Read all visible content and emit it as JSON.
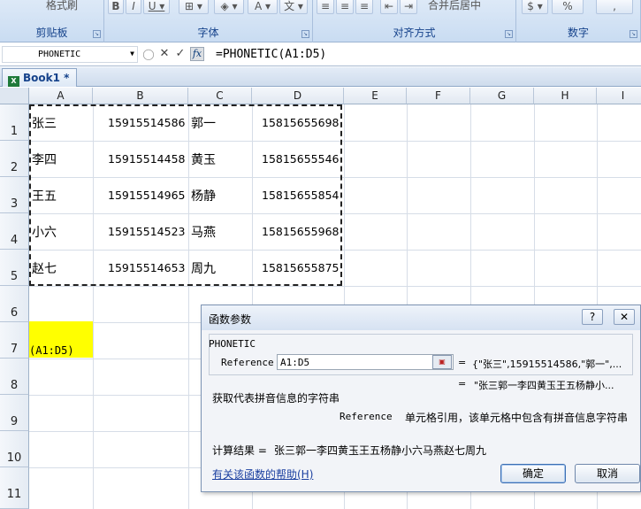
{
  "ribbon": {
    "groups": [
      {
        "label": "剪贴板"
      },
      {
        "label": "字体"
      },
      {
        "label": "对齐方式"
      },
      {
        "label": "数字"
      }
    ],
    "format_painter_label": "格式刷",
    "merge_center_label": "合并后居中",
    "percent_label": "%"
  },
  "formula_bar": {
    "name_box": "PHONETIC",
    "fx_label": "fx",
    "formula": "=PHONETIC(A1:D5)"
  },
  "workbook": {
    "tab_label": "Book1 *"
  },
  "sheet": {
    "columns": [
      "A",
      "B",
      "C",
      "D",
      "E",
      "F",
      "G",
      "H",
      "I"
    ],
    "rows": [
      "1",
      "2",
      "3",
      "4",
      "5",
      "6",
      "7",
      "8",
      "9",
      "10",
      "11"
    ],
    "data": [
      [
        "张三",
        "15915514586",
        "郭一",
        "15815655698"
      ],
      [
        "李四",
        "15915514458",
        "黄玉",
        "15815655546"
      ],
      [
        "王五",
        "15915514965",
        "杨静",
        "15815655854"
      ],
      [
        "小六",
        "15915514523",
        "马燕",
        "15815655968"
      ],
      [
        "赵七",
        "15915514653",
        "周九",
        "15815655875"
      ]
    ],
    "a7_text": "(A1:D5)",
    "a7_fill": "#ffff00"
  },
  "dialog": {
    "title": "函数参数",
    "help_button": "?",
    "close_button": "✕",
    "function_name": "PHONETIC",
    "arg_label": "Reference",
    "arg_value": "A1:D5",
    "arg_eq": "=",
    "arg_evaluated": "{\"张三\",15915514586,\"郭一\",...",
    "result_eq": "=",
    "result_preview": "\"张三郭一李四黄玉王五杨静小...",
    "function_description": "获取代表拼音信息的字符串",
    "arg_desc_name": "Reference",
    "arg_desc_text": "单元格引用，该单元格中包含有拼音信息字符串",
    "calc_result_label": "计算结果 =",
    "calc_result_value": "张三郭一李四黄玉王五杨静小六马燕赵七周九",
    "help_link": "有关该函数的帮助(H)",
    "ok_label": "确定",
    "cancel_label": "取消"
  },
  "colors": {
    "selection_marquee": "#222222",
    "highlight_yellow": "#ffff00",
    "ribbon_label": "#15428b"
  }
}
